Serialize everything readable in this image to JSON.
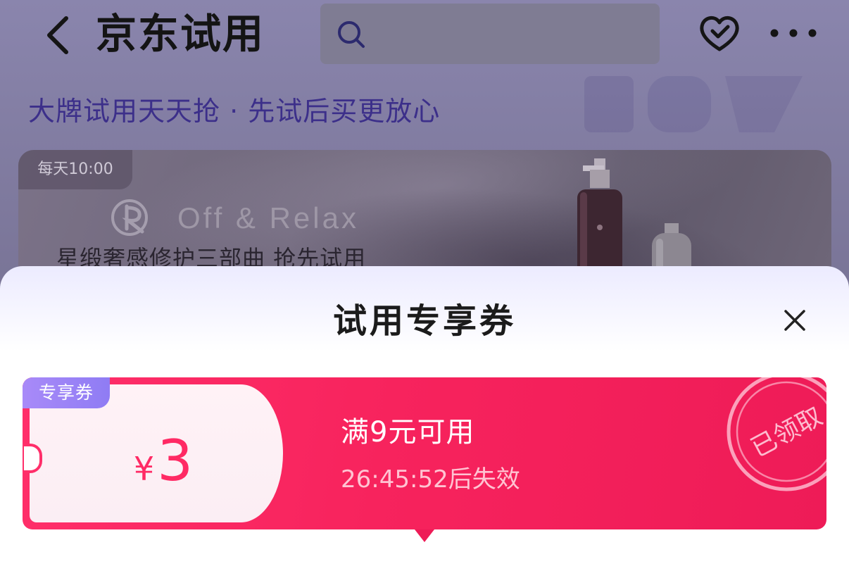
{
  "header": {
    "title": "京东试用",
    "search_placeholder": "",
    "back_icon": "chevron-left-icon",
    "favorite_icon": "heart-icon",
    "more_icon": "more-dots-icon"
  },
  "banner": {
    "slogan": "大牌试用天天抢 · 先试后买更放心",
    "promo": {
      "time_tag": "每天10:00",
      "brand_name": "Off & Relax",
      "title": "星缎奢感修护三部曲 抢先试用"
    }
  },
  "coupon_sheet": {
    "title": "试用专享券",
    "close_icon": "close-icon",
    "coupon": {
      "tag": "专享券",
      "currency": "¥",
      "amount": "3",
      "condition": "满9元可用",
      "expiry": "26:45:52后失效",
      "status_stamp": "已领取"
    }
  },
  "colors": {
    "coupon_red": "#f7235d",
    "coupon_tag_purple": "#9a82f6",
    "slogan_purple": "#3c2f8a"
  }
}
